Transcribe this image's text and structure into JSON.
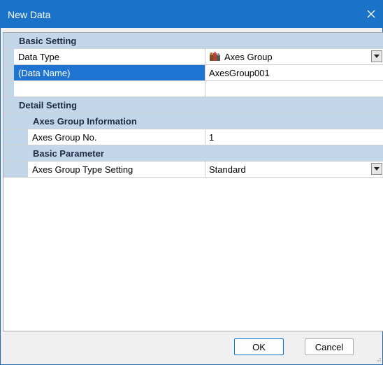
{
  "window": {
    "title": "New Data",
    "close_icon": "close-icon",
    "accent_color": "#1a73c9"
  },
  "grid": {
    "basic_setting": {
      "label": "Basic Setting",
      "rows": [
        {
          "name": "Data Type",
          "value": "Axes Group",
          "icon": "axes-group-icon",
          "dropdown": true
        },
        {
          "name": "(Data Name)",
          "value": "AxesGroup001",
          "selected": true
        },
        {
          "name": "",
          "value": ""
        }
      ]
    },
    "detail_setting": {
      "label": "Detail Setting",
      "axes_group_information": {
        "label": "Axes Group Information",
        "rows": [
          {
            "name": "Axes Group No.",
            "value": "1"
          }
        ]
      },
      "basic_parameter": {
        "label": "Basic Parameter",
        "rows": [
          {
            "name": "Axes Group Type Setting",
            "value": "Standard",
            "dropdown": true
          }
        ]
      }
    }
  },
  "buttons": {
    "ok": "OK",
    "cancel": "Cancel"
  }
}
